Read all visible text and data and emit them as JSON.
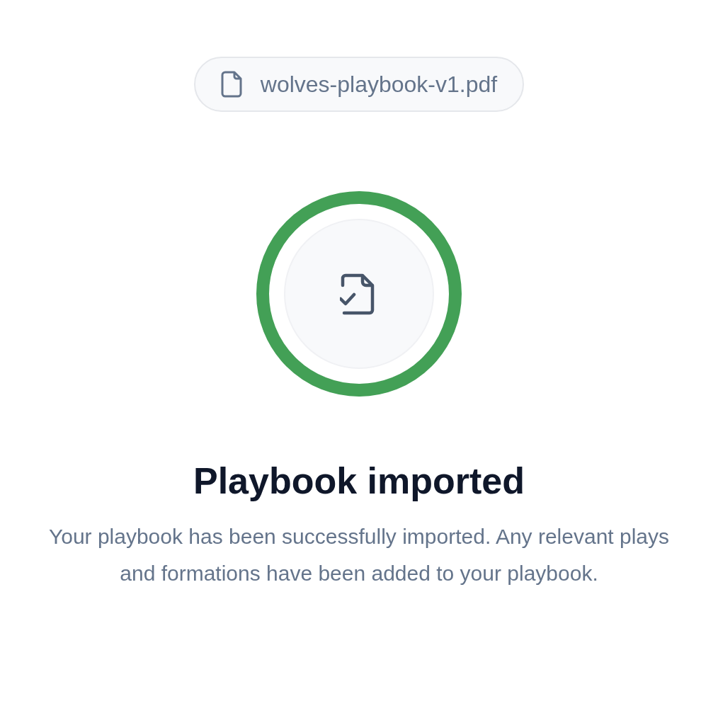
{
  "file_chip": {
    "filename": "wolves-playbook-v1.pdf"
  },
  "progress_ring": {
    "level": 1
  },
  "title": "Playbook imported",
  "message": "Your playbook has been successfully imported. Any relevant plays and formations have been added to your playbook."
}
